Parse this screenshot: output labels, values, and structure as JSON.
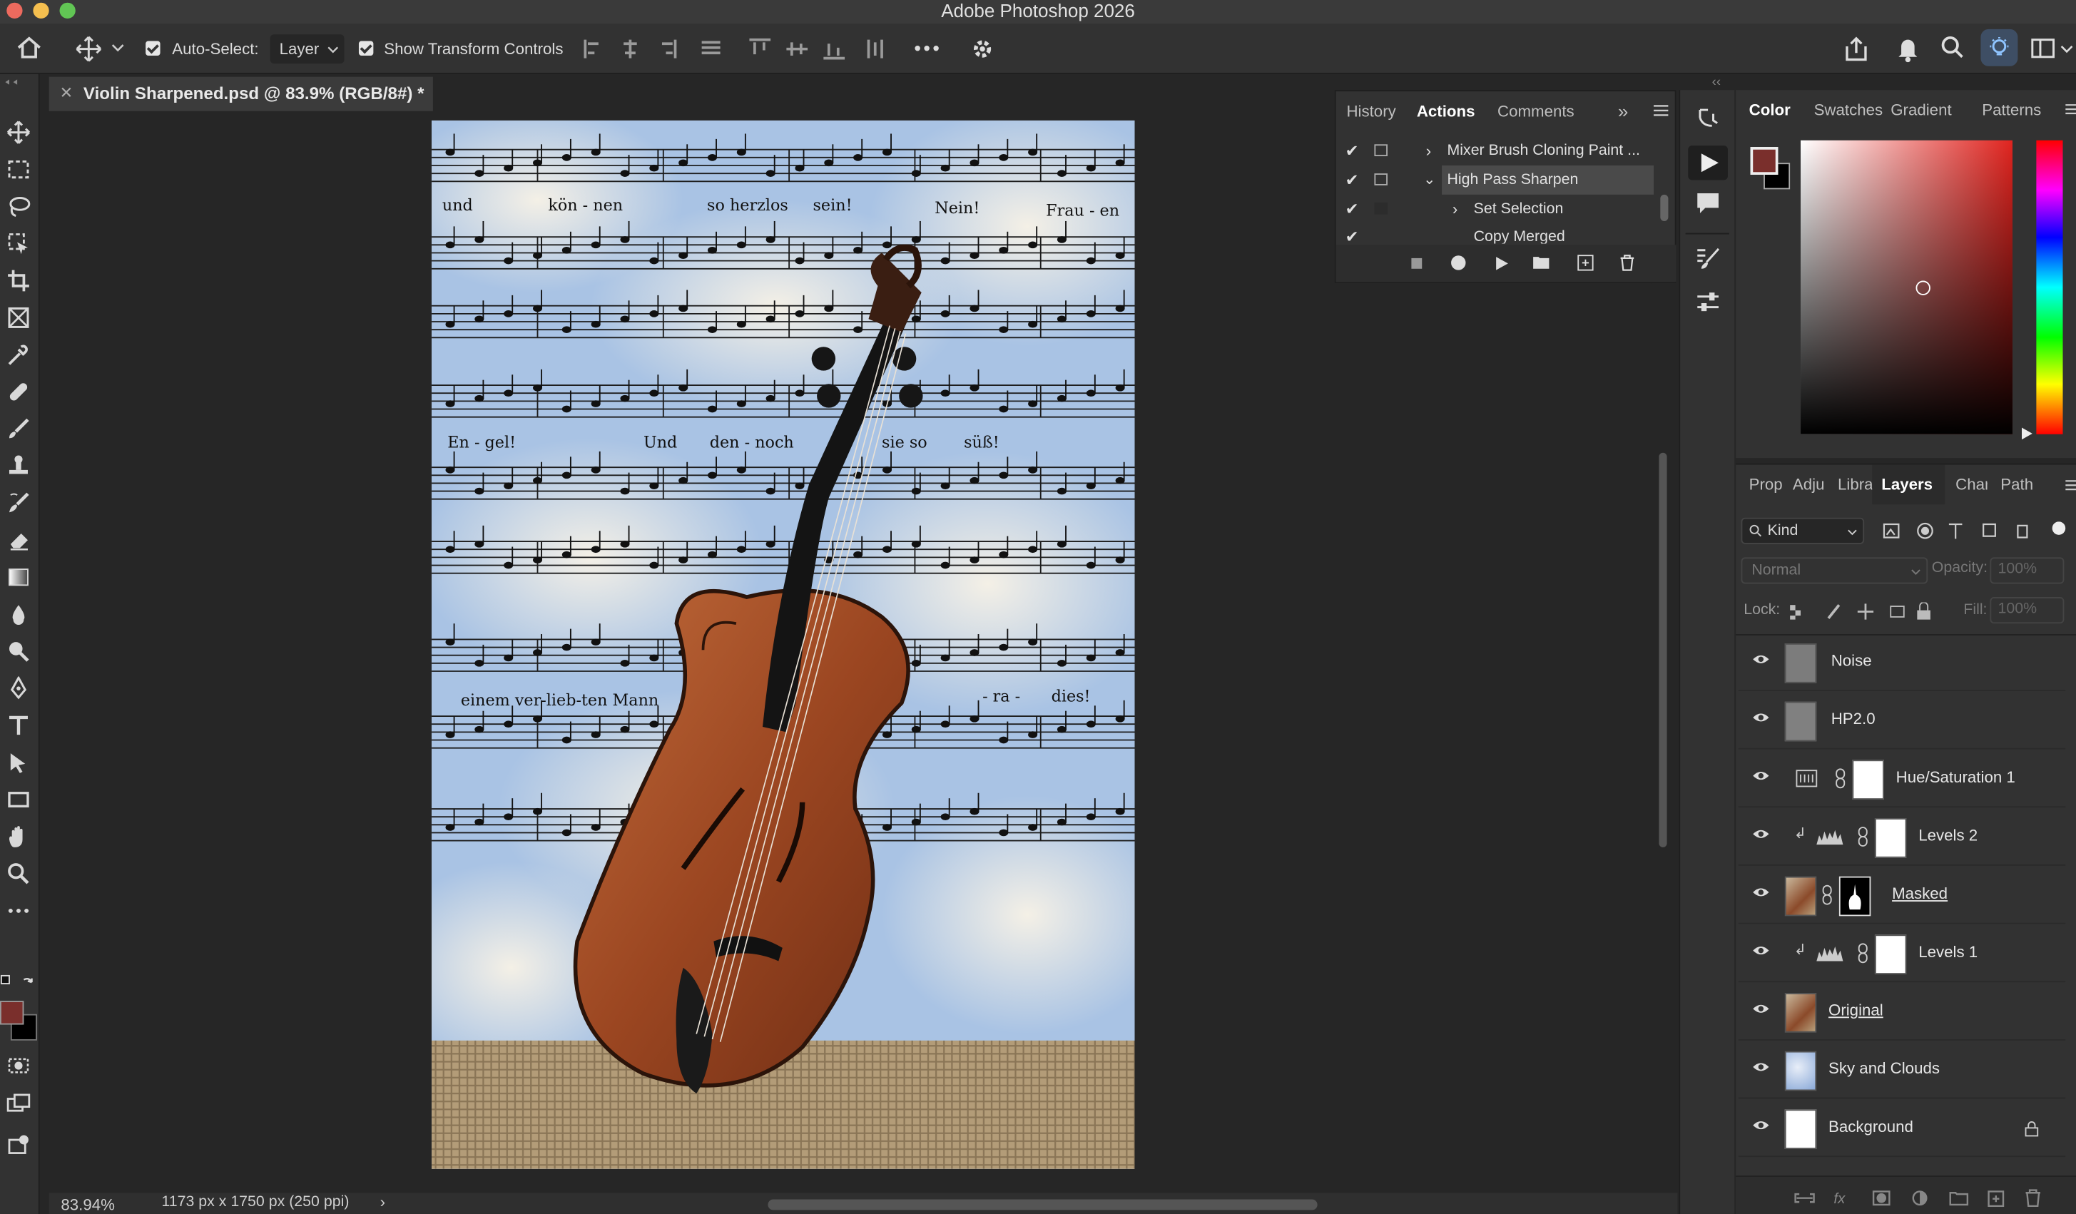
{
  "app": {
    "title": "Adobe Photoshop 2026"
  },
  "options": {
    "auto_select_label": "Auto-Select:",
    "auto_select_value": "Layer",
    "transform_label": "Show Transform Controls"
  },
  "document": {
    "tab_title": "Violin Sharpened.psd @ 83.9% (RGB/8#) *"
  },
  "status": {
    "zoom": "83.94%",
    "dimensions": "1173 px x 1750 px (250 ppi)"
  },
  "actions_panel": {
    "tabs": [
      "History",
      "Actions",
      "Comments"
    ],
    "rows": [
      {
        "label": "Mixer Brush Cloning Paint ..."
      },
      {
        "label": "High Pass Sharpen"
      },
      {
        "label": "Set Selection"
      },
      {
        "label": "Copy Merged"
      }
    ]
  },
  "color_panel": {
    "tabs": [
      "Color",
      "Swatches",
      "Gradient",
      "Patterns"
    ],
    "foreground": "#7a2f2c",
    "background": "#000000"
  },
  "layers_panel": {
    "tabs": [
      "Prop",
      "Adju",
      "Libra",
      "Layers",
      "Char",
      "Path"
    ],
    "filter": "Kind",
    "blend_mode": "Normal",
    "opacity_label": "Opacity:",
    "opacity_value": "100%",
    "lock_label": "Lock:",
    "fill_label": "Fill:",
    "fill_value": "100%",
    "layers": [
      {
        "name": "Noise"
      },
      {
        "name": "HP2.0"
      },
      {
        "name": "Hue/Saturation 1"
      },
      {
        "name": "Levels 2"
      },
      {
        "name": "Masked"
      },
      {
        "name": "Levels 1"
      },
      {
        "name": "Original"
      },
      {
        "name": "Sky and Clouds"
      },
      {
        "name": "Background"
      }
    ]
  },
  "photo": {
    "lyrics": [
      "und",
      "kön - nen",
      "so herzlos",
      "sein!",
      "Nein!",
      "Frau - en",
      "En - gel!",
      "Und",
      "den - noch",
      "sie so",
      "süß!",
      "einem ver-lieb-ten Mann",
      "- ra -",
      "dies!"
    ]
  }
}
